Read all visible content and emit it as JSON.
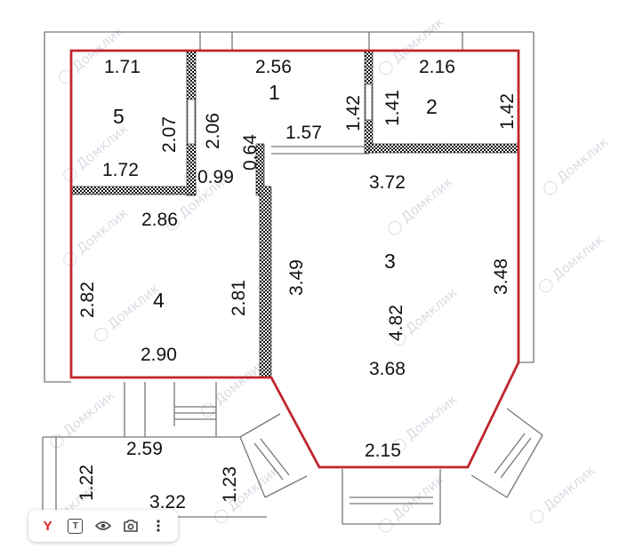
{
  "watermark": "Домклик",
  "rooms": [
    {
      "number": "1",
      "dims": [
        "2.56",
        "2.06",
        "1.42",
        "1.57",
        "0.64",
        "0.99"
      ]
    },
    {
      "number": "2",
      "dims": [
        "2.16",
        "1.41",
        "1.42"
      ]
    },
    {
      "number": "3",
      "dims": [
        "3.72",
        "3.49",
        "3.48",
        "4.82",
        "3.68",
        "2.15"
      ]
    },
    {
      "number": "4",
      "dims": [
        "2.86",
        "2.82",
        "2.81",
        "2.90"
      ]
    },
    {
      "number": "5",
      "dims": [
        "1.71",
        "2.07",
        "1.72"
      ]
    }
  ],
  "balcony": {
    "dims": [
      "2.59",
      "1.22",
      "1.23",
      "3.22"
    ]
  },
  "toolbar": {
    "y_label": "Y",
    "text_label": "T",
    "icons": [
      "yandex-icon",
      "text-recognition-icon",
      "eye-icon",
      "camera-search-icon",
      "more-icon"
    ]
  },
  "colors": {
    "outline": "#c0262d",
    "wall": "#111111",
    "thin_line": "#777777"
  }
}
